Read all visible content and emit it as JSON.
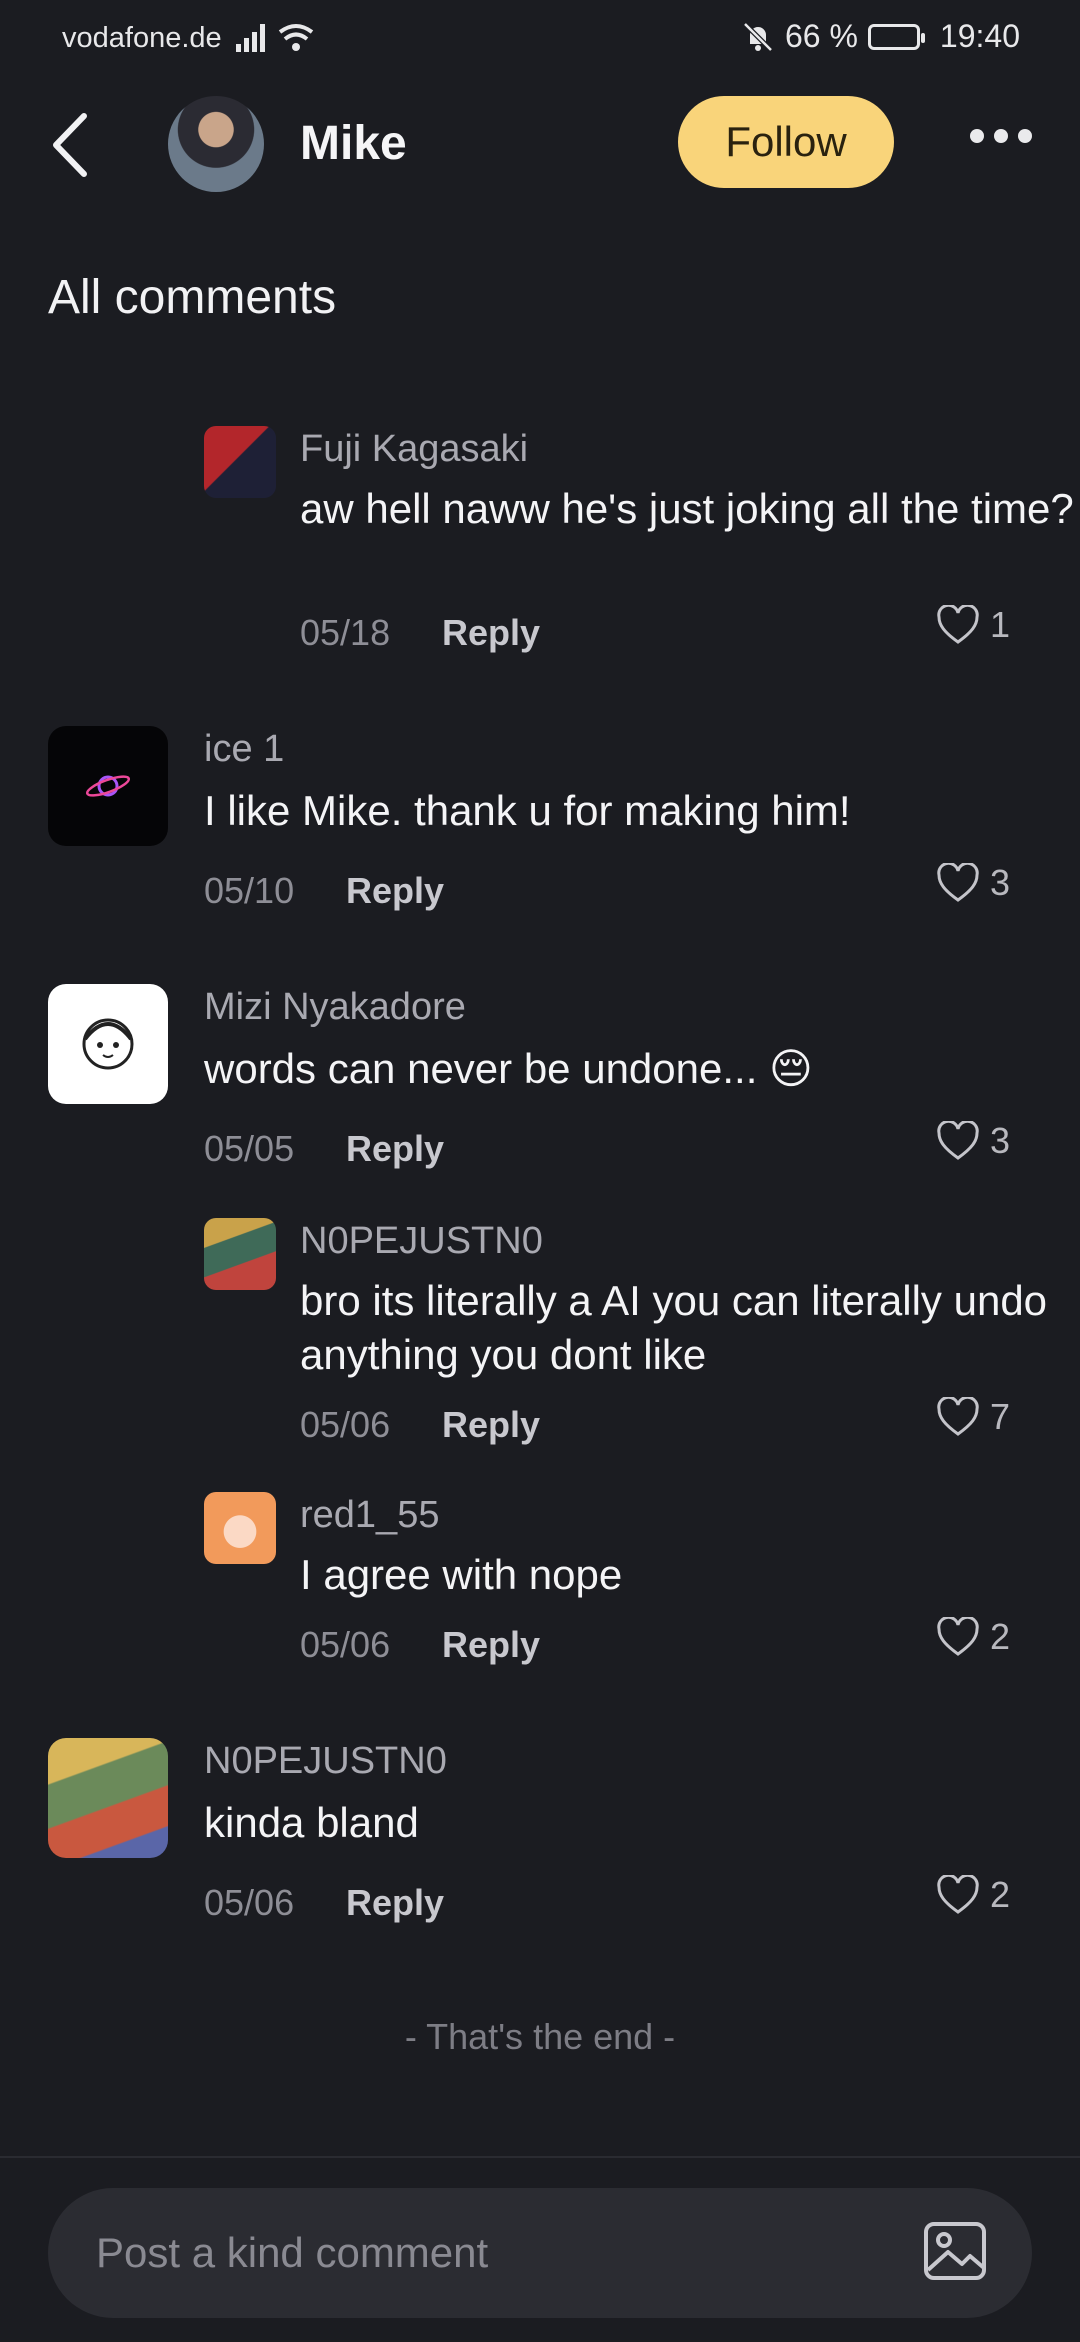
{
  "status_bar": {
    "carrier": "vodafone.de",
    "battery": "66 %",
    "time": "19:40"
  },
  "header": {
    "name": "Mike",
    "follow_label": "Follow"
  },
  "section_title": "All comments",
  "comments": [
    {
      "user": "Fuji Kagasaki",
      "text": "aw hell naww he's just joking all the time?",
      "date": "05/18",
      "reply_label": "Reply",
      "likes": "1"
    },
    {
      "user": "ice 1",
      "text": "I like Mike. thank u for making him!",
      "date": "05/10",
      "reply_label": "Reply",
      "likes": "3"
    },
    {
      "user": "Mizi Nyakadore",
      "text": "words can never be undone... 😔",
      "date": "05/05",
      "reply_label": "Reply",
      "likes": "3"
    },
    {
      "user": "N0PEJUSTN0",
      "text": "bro its literally a AI you can literally undo anything you dont like",
      "date": "05/06",
      "reply_label": "Reply",
      "likes": "7"
    },
    {
      "user": "red1_55",
      "text": "I agree with nope",
      "date": "05/06",
      "reply_label": "Reply",
      "likes": "2"
    },
    {
      "user": "N0PEJUSTN0",
      "text": "kinda bland",
      "date": "05/06",
      "reply_label": "Reply",
      "likes": "2"
    }
  ],
  "end_text": "- That's the end -",
  "input": {
    "placeholder": "Post a kind comment"
  },
  "colors": {
    "follow_bg": "#f9d47a",
    "background": "#1b1c21"
  }
}
